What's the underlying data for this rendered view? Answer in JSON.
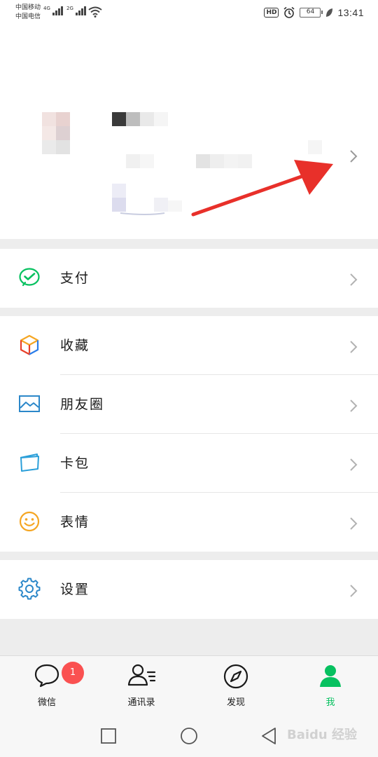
{
  "status_bar": {
    "carrier1": "中国移动",
    "carrier2": "中国电信",
    "net1": "4G",
    "net2": "2G",
    "hd": "HD",
    "battery": "64",
    "time": "13:41"
  },
  "menu": {
    "pay": "支付",
    "favorites": "收藏",
    "moments": "朋友圈",
    "cards": "卡包",
    "stickers": "表情",
    "settings": "设置"
  },
  "tabs": [
    {
      "label": "微信",
      "badge": "1"
    },
    {
      "label": "通讯录"
    },
    {
      "label": "发现"
    },
    {
      "label": "我"
    }
  ],
  "colors": {
    "brand_green": "#07c160",
    "badge_red": "#fa5151",
    "annotation_arrow": "#e8302a"
  },
  "watermark": "Baidu 经验"
}
